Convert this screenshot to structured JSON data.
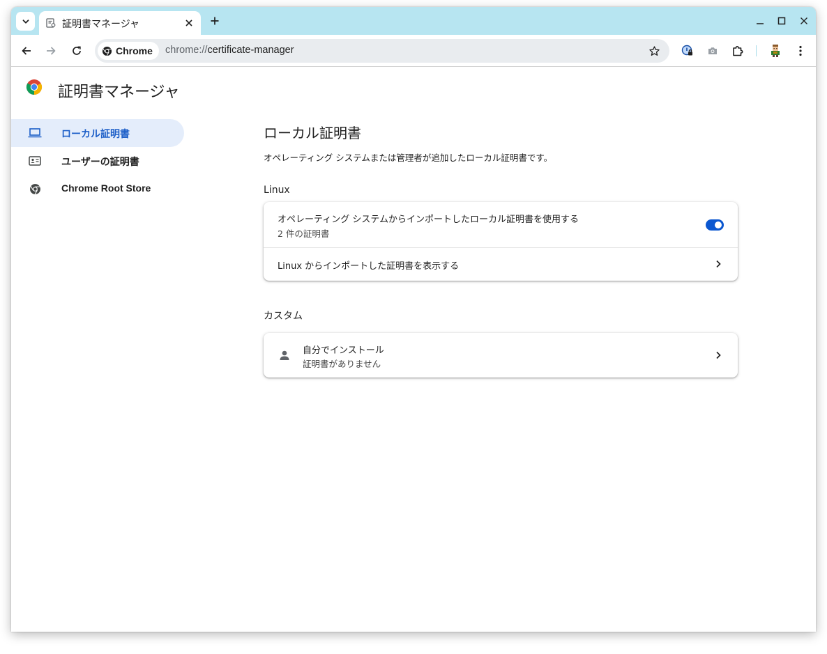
{
  "browser": {
    "tab": {
      "title": "証明書マネージャ"
    },
    "omnibox": {
      "chip_label": "Chrome",
      "url_scheme": "chrome://",
      "url_host": "certificate-manager"
    }
  },
  "page": {
    "title": "証明書マネージャ",
    "nav": [
      {
        "label": "ローカル証明書",
        "icon": "laptop-icon",
        "active": true
      },
      {
        "label": "ユーザーの証明書",
        "icon": "id-card-icon",
        "active": false
      },
      {
        "label": "Chrome Root Store",
        "icon": "chrome-icon",
        "active": false
      }
    ],
    "main": {
      "title": "ローカル証明書",
      "description": "オペレーティング システムまたは管理者が追加したローカル証明書です。",
      "linux": {
        "heading": "Linux",
        "use_imported": {
          "label": "オペレーティング システムからインポートしたローカル証明書を使用する",
          "sublabel": "2 件の証明書",
          "enabled": true
        },
        "view_imported": {
          "label": "Linux からインポートした証明書を表示する"
        }
      },
      "custom": {
        "heading": "カスタム",
        "installed": {
          "label": "自分でインストール",
          "sublabel": "証明書がありません"
        }
      }
    }
  },
  "colors": {
    "tabstrip": "#b7e5f1",
    "accent": "#0b57d0",
    "nav_active_bg": "#e4edfb",
    "nav_active_text": "#1d5fc8"
  }
}
